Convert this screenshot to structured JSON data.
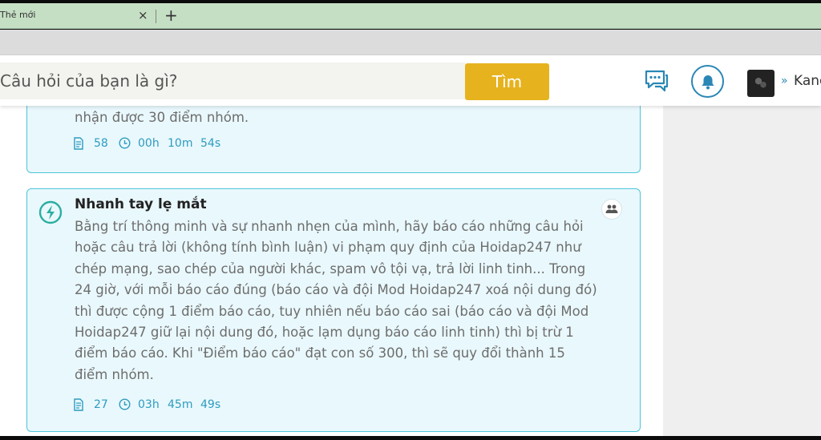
{
  "browser": {
    "tab_title": "Thẻ mới",
    "tab_close": "×",
    "new_tab": "+"
  },
  "header": {
    "search_placeholder": "Câu hỏi của bạn là gì?",
    "search_button": "Tìm",
    "user_chevron": "»",
    "user_name": "Kane"
  },
  "cards": [
    {
      "text_lines": [
        "nhận được 30 điểm nhóm."
      ],
      "count": "58",
      "time": [
        "00h",
        "10m",
        "54s"
      ]
    },
    {
      "title": "Nhanh tay lẹ mắt",
      "text_lines": [
        "Bằng trí thông minh và sự nhanh nhẹn của mình, hãy báo cáo những câu hỏi",
        "hoặc câu trả lời (không tính bình luận) vi phạm quy định của Hoidap247 như",
        "chép mạng, sao chép của người khác, spam vô tội vạ, trả lời linh tinh... Trong",
        "24 giờ, với mỗi báo cáo đúng (báo cáo và đội Mod Hoidap247 xoá nội dung đó)",
        "thì được cộng 1 điểm báo cáo, tuy nhiên nếu báo cáo sai (báo cáo và đội Mod",
        "Hoidap247 giữ lại nội dung đó, hoặc lạm dụng báo cáo linh tinh) thì bị trừ 1",
        "điểm báo cáo. Khi \"Điểm báo cáo\" đạt con số 300, thì sẽ quy đổi thành 15",
        "điểm nhóm."
      ],
      "count": "27",
      "time": [
        "03h",
        "45m",
        "49s"
      ]
    }
  ],
  "colors": {
    "accent": "#2e9bc0",
    "card_border": "#4fc4dc",
    "card_bg": "#e9f8fc",
    "search_button": "#e6b21e",
    "tabbar": "#c5dfc5"
  },
  "icons": {
    "chat": "chat-bubbles-icon",
    "bell": "bell-icon",
    "bolt": "lightning-icon",
    "group": "group-icon",
    "doc": "document-icon",
    "clock": "clock-icon"
  }
}
